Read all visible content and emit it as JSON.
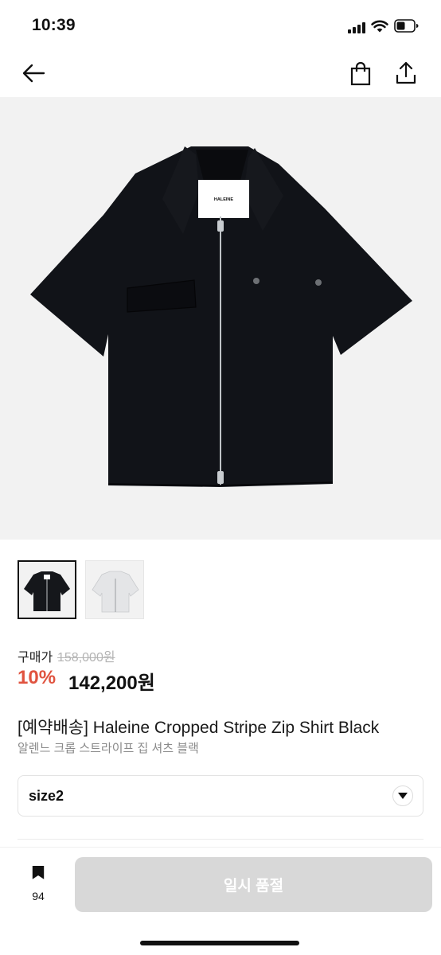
{
  "status_bar": {
    "time": "10:39"
  },
  "nav": {
    "back_icon": "arrow-left-icon",
    "cart_icon": "shopping-bag-icon",
    "share_icon": "share-upload-icon"
  },
  "hero": {
    "image": "black-zip-shirt-photo",
    "brand_tag": "HALEINE"
  },
  "thumbnails": [
    {
      "name": "black-shirt-thumbnail",
      "selected": true
    },
    {
      "name": "white-shirt-thumbnail",
      "selected": false
    }
  ],
  "price": {
    "label": "구매가",
    "original": "158,000원",
    "discount": "10%",
    "sale": "142,200원"
  },
  "product": {
    "title": "[예약배송] Haleine Cropped Stripe Zip Shirt Black",
    "subtitle": "알렌느 크롭 스트라이프 집 셔츠 블랙"
  },
  "option": {
    "selected": "size2",
    "caret_icon": "chevron-down-icon"
  },
  "bottom_bar": {
    "bookmark_icon": "bookmark-icon",
    "bookmark_count": "94",
    "button_label": "일시 품절"
  },
  "colors": {
    "discount": "#e0533f",
    "button_disabled": "#d8d8d8",
    "image_background": "#f2f2f2"
  }
}
